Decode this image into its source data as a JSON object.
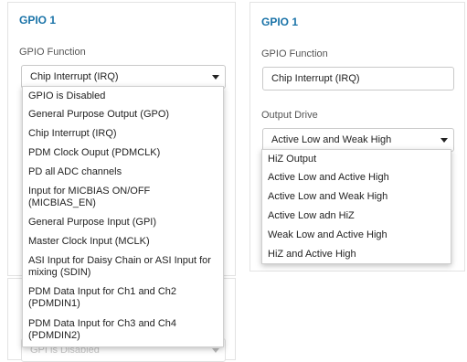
{
  "left": {
    "title": "GPIO 1",
    "function_label": "GPIO Function",
    "function_value": "Chip Interrupt (IRQ)",
    "function_options": [
      "GPIO is Disabled",
      "General Purpose Output (GPO)",
      "Chip Interrupt (IRQ)",
      "PDM Clock Ouput (PDMCLK)",
      "PD all ADC channels",
      "Input for MICBIAS ON/OFF (MICBIAS_EN)",
      "General Purpose Input (GPI)",
      "Master Clock Input (MCLK)",
      "ASI Input for Daisy Chain or ASI Input for mixing (SDIN)",
      "PDM Data Input for Ch1 and Ch2 (PDMDIN1)",
      "PDM Data Input for Ch3 and Ch4 (PDMDIN2)"
    ],
    "lower_select_partial": "GPI is Disabled"
  },
  "right": {
    "title": "GPIO 1",
    "function_label": "GPIO Function",
    "function_value": "Chip Interrupt (IRQ)",
    "drive_label": "Output Drive",
    "drive_value": "Active Low and Weak High",
    "drive_options": [
      "HiZ Output",
      "Active Low and Active High",
      "Active Low and Weak High",
      "Active Low adn HiZ",
      "Weak Low and Active High",
      "HiZ and Active High"
    ]
  },
  "colors": {
    "title": "#1a73a8",
    "menu_border": "#cfcfcf"
  }
}
